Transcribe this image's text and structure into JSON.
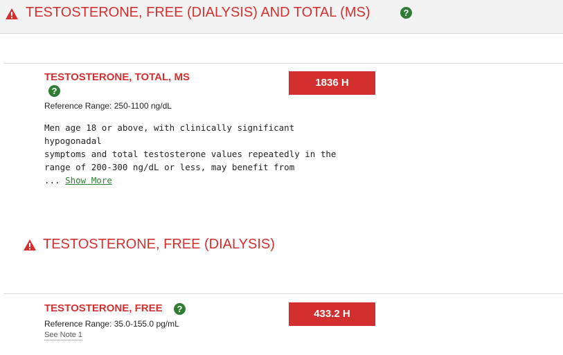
{
  "header": {
    "title": "TESTOSTERONE, FREE (DIALYSIS) AND TOTAL (MS)",
    "help_glyph": "?"
  },
  "tests": [
    {
      "name": "TESTOSTERONE, TOTAL, MS",
      "help_glyph": "?",
      "reference_range": "Reference Range: 250-1100 ng/dL",
      "result": "1836 H",
      "comment_lines": [
        "Men age 18 or above, with clinically significant",
        "hypogonadal",
        "symptoms and total testosterone values repeatedly in the",
        "range of 200-300 ng/dL or less, may benefit from"
      ],
      "comment_ellipsis": "... ",
      "show_more": "Show More"
    },
    {
      "section_title": "TESTOSTERONE, FREE (DIALYSIS)",
      "name": "TESTOSTERONE, FREE",
      "help_glyph": "?",
      "reference_range": "Reference Range: 35.0-155.0 pg/mL",
      "result": "433.2 H",
      "note_link": "See Note 1"
    }
  ],
  "colors": {
    "alert_red": "#d32f2f",
    "help_green": "#2e7d32",
    "header_bg": "#f3f3f3"
  },
  "icons": {
    "warning": "warning-triangle-icon",
    "help": "help-circle-icon"
  }
}
